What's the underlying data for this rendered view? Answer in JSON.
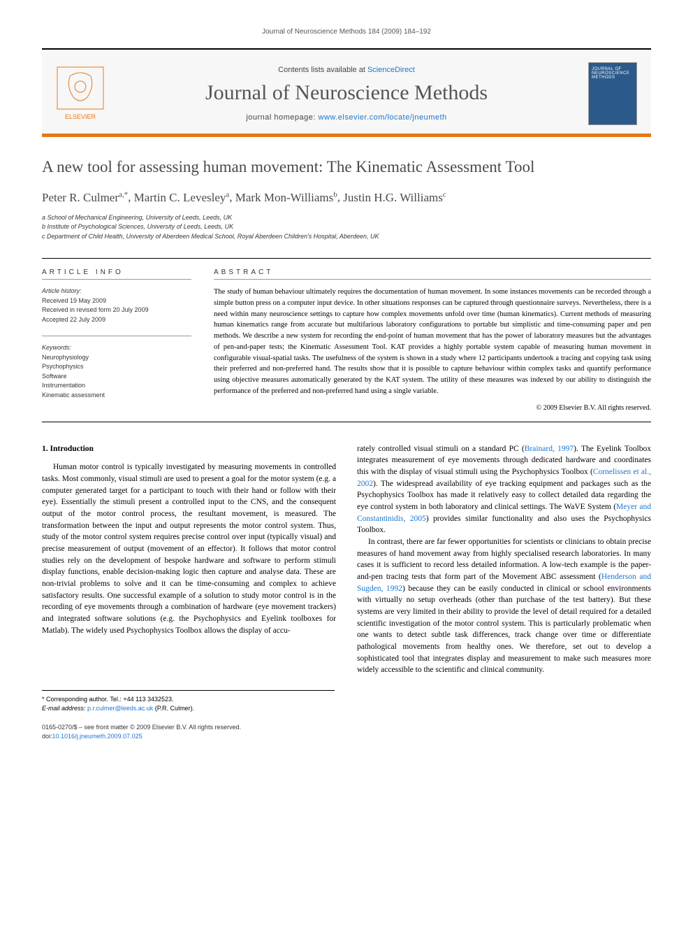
{
  "header": {
    "citation": "Journal of Neuroscience Methods 184 (2009) 184–192",
    "contents_prefix": "Contents lists available at ",
    "contents_link": "ScienceDirect",
    "journal_name": "Journal of Neuroscience Methods",
    "homepage_prefix": "journal homepage: ",
    "homepage_url": "www.elsevier.com/locate/jneumeth",
    "publisher_logo_label": "ELSEVIER",
    "cover_label": "JOURNAL OF NEUROSCIENCE METHODS"
  },
  "article": {
    "title": "A new tool for assessing human movement: The Kinematic Assessment Tool",
    "authors_html": "Peter R. Culmer",
    "authors": [
      {
        "name": "Peter R. Culmer",
        "marks": "a,*"
      },
      {
        "name": "Martin C. Levesley",
        "marks": "a"
      },
      {
        "name": "Mark Mon-Williams",
        "marks": "b"
      },
      {
        "name": "Justin H.G. Williams",
        "marks": "c"
      }
    ],
    "affiliations": [
      "a School of Mechanical Engineering, University of Leeds, Leeds, UK",
      "b Institute of Psychological Sciences, University of Leeds, Leeds, UK",
      "c Department of Child Health, University of Aberdeen Medical School, Royal Aberdeen Children's Hospital, Aberdeen, UK"
    ]
  },
  "info": {
    "heading": "ARTICLE INFO",
    "history_label": "Article history:",
    "history": [
      "Received 19 May 2009",
      "Received in revised form 20 July 2009",
      "Accepted 22 July 2009"
    ],
    "keywords_label": "Keywords:",
    "keywords": [
      "Neurophysiology",
      "Psychophysics",
      "Software",
      "Instrumentation",
      "Kinematic assessment"
    ]
  },
  "abstract": {
    "heading": "ABSTRACT",
    "text": "The study of human behaviour ultimately requires the documentation of human movement. In some instances movements can be recorded through a simple button press on a computer input device. In other situations responses can be captured through questionnaire surveys. Nevertheless, there is a need within many neuroscience settings to capture how complex movements unfold over time (human kinematics). Current methods of measuring human kinematics range from accurate but multifarious laboratory configurations to portable but simplistic and time-consuming paper and pen methods. We describe a new system for recording the end-point of human movement that has the power of laboratory measures but the advantages of pen-and-paper tests; the Kinematic Assessment Tool. KAT provides a highly portable system capable of measuring human movement in configurable visual-spatial tasks. The usefulness of the system is shown in a study where 12 participants undertook a tracing and copying task using their preferred and non-preferred hand. The results show that it is possible to capture behaviour within complex tasks and quantify performance using objective measures automatically generated by the KAT system. The utility of these measures was indexed by our ability to distinguish the performance of the preferred and non-preferred hand using a single variable.",
    "copyright": "© 2009 Elsevier B.V. All rights reserved."
  },
  "body": {
    "section_heading": "1. Introduction",
    "col1_p1": "Human motor control is typically investigated by measuring movements in controlled tasks. Most commonly, visual stimuli are used to present a goal for the motor system (e.g. a computer generated target for a participant to touch with their hand or follow with their eye). Essentially the stimuli present a controlled input to the CNS, and the consequent output of the motor control process, the resultant movement, is measured. The transformation between the input and output represents the motor control system. Thus, study of the motor control system requires precise control over input (typically visual) and precise measurement of output (movement of an effector). It follows that motor control studies rely on the development of bespoke hardware and software to perform stimuli display functions, enable decision-making logic then capture and analyse data. These are non-trivial problems to solve and it can be time-consuming and complex to achieve satisfactory results. One successful example of a solution to study motor control is in the recording of eye movements through a combination of hardware (eye movement trackers) and integrated software solutions (e.g. the Psychophysics and Eyelink toolboxes for Matlab). The widely used Psychophysics Toolbox allows the display of accu-",
    "col2_p1a": "rately controlled visual stimuli on a standard PC (",
    "col2_ref1": "Brainard, 1997",
    "col2_p1b": "). The Eyelink Toolbox integrates measurement of eye movements through dedicated hardware and coordinates this with the display of visual stimuli using the Psychophysics Toolbox (",
    "col2_ref2": "Cornelissen et al., 2002",
    "col2_p1c": "). The widespread availability of eye tracking equipment and packages such as the Psychophysics Toolbox has made it relatively easy to collect detailed data regarding the eye control system in both laboratory and clinical settings. The WaVE System (",
    "col2_ref3": "Meyer and Constantinidis, 2005",
    "col2_p1d": ") provides similar functionality and also uses the Psychophysics Toolbox.",
    "col2_p2a": "In contrast, there are far fewer opportunities for scientists or clinicians to obtain precise measures of hand movement away from highly specialised research laboratories. In many cases it is sufficient to record less detailed information. A low-tech example is the paper-and-pen tracing tests that form part of the Movement ABC assessment (",
    "col2_ref4": "Henderson and Sugden, 1992",
    "col2_p2b": ") because they can be easily conducted in clinical or school environments with virtually no setup overheads (other than purchase of the test battery). But these systems are very limited in their ability to provide the level of detail required for a detailed scientific investigation of the motor control system. This is particularly problematic when one wants to detect subtle task differences, track change over time or differentiate pathological movements from healthy ones. We therefore, set out to develop a sophisticated tool that integrates display and measurement to make such measures more widely accessible to the scientific and clinical community."
  },
  "footnotes": {
    "corr_label": "* Corresponding author. Tel.: +44 113 3432523.",
    "email_label": "E-mail address: ",
    "email": "p.r.culmer@leeds.ac.uk",
    "email_suffix": " (P.R. Culmer)."
  },
  "footer": {
    "line1": "0165-0270/$ – see front matter © 2009 Elsevier B.V. All rights reserved.",
    "doi_prefix": "doi:",
    "doi": "10.1016/j.jneumeth.2009.07.025"
  }
}
